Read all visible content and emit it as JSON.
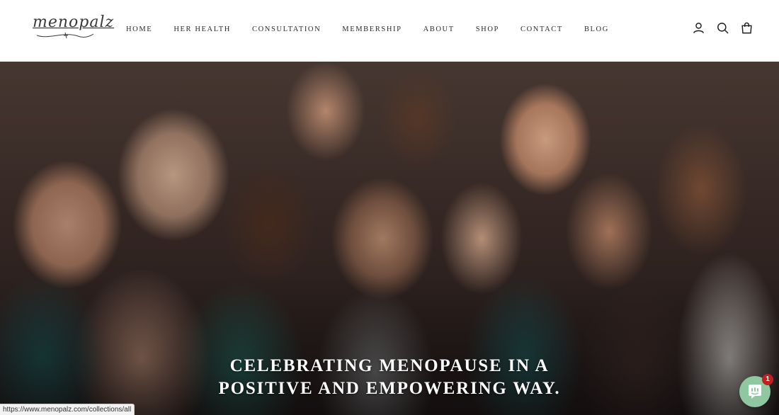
{
  "brand": {
    "logo_text": "menopalz"
  },
  "nav": {
    "items": [
      "HOME",
      "HER HEALTH",
      "CONSULTATION",
      "MEMBERSHIP",
      "ABOUT",
      "SHOP",
      "CONTACT",
      "BLOG"
    ]
  },
  "header_icons": [
    "account-icon",
    "search-icon",
    "cart-icon"
  ],
  "hero": {
    "heading_line1": "CELEBRATING MENOPAUSE IN A",
    "heading_line2": "POSITIVE AND EMPOWERING WAY."
  },
  "status_bar": {
    "url": "https://www.menopalz.com/collections/all"
  },
  "chat": {
    "badge_count": "1",
    "icon": "chat-icon",
    "color": "#8fc7a1"
  }
}
